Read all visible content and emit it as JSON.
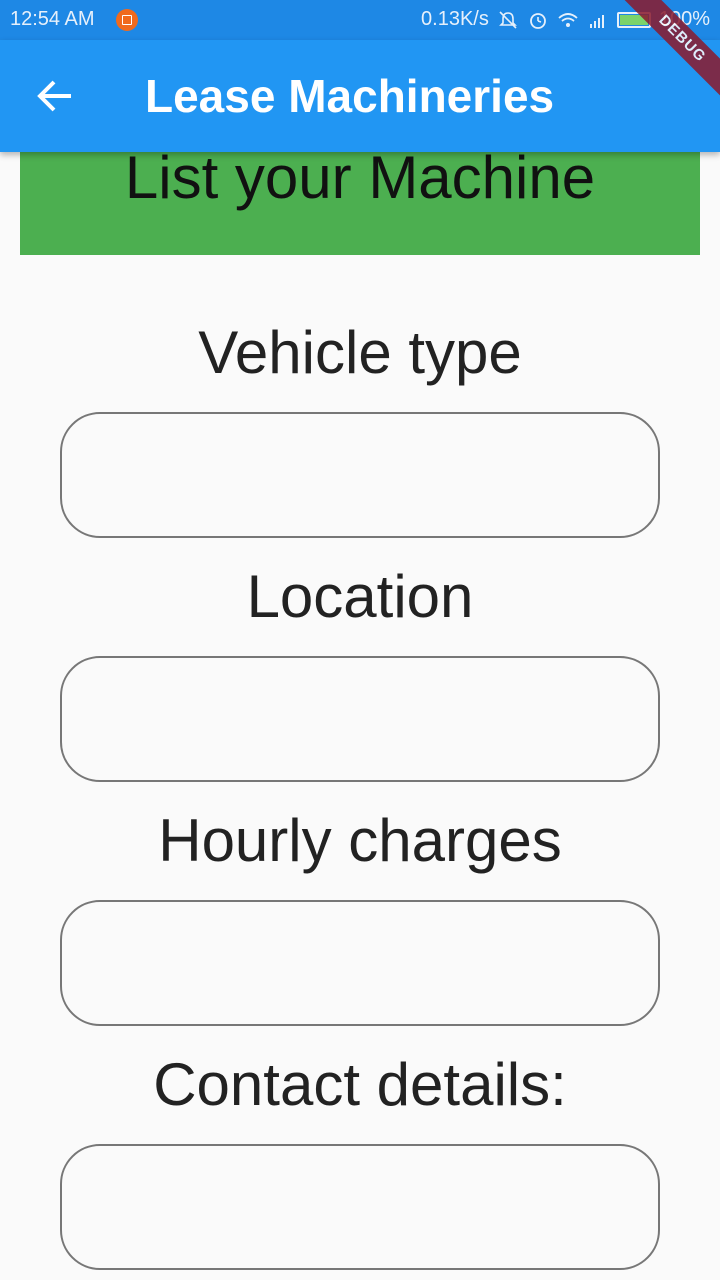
{
  "status_bar": {
    "time": "12:54 AM",
    "network_speed": "0.13K/s",
    "battery": "100%",
    "icons": [
      "notification-icon",
      "mute-icon",
      "alarm-icon",
      "wifi-icon",
      "signal-icon",
      "battery-icon"
    ]
  },
  "app_bar": {
    "title": "Lease Machineries",
    "back_icon": "arrow-back-icon",
    "debug_label": "DEBUG",
    "color": "#2196f3"
  },
  "banner": {
    "text": "List your Machine",
    "color": "#4caf50"
  },
  "form": {
    "fields": [
      {
        "label": "Vehicle type",
        "value": ""
      },
      {
        "label": "Location",
        "value": ""
      },
      {
        "label": "Hourly charges",
        "value": ""
      },
      {
        "label": "Contact details:",
        "value": ""
      }
    ]
  }
}
